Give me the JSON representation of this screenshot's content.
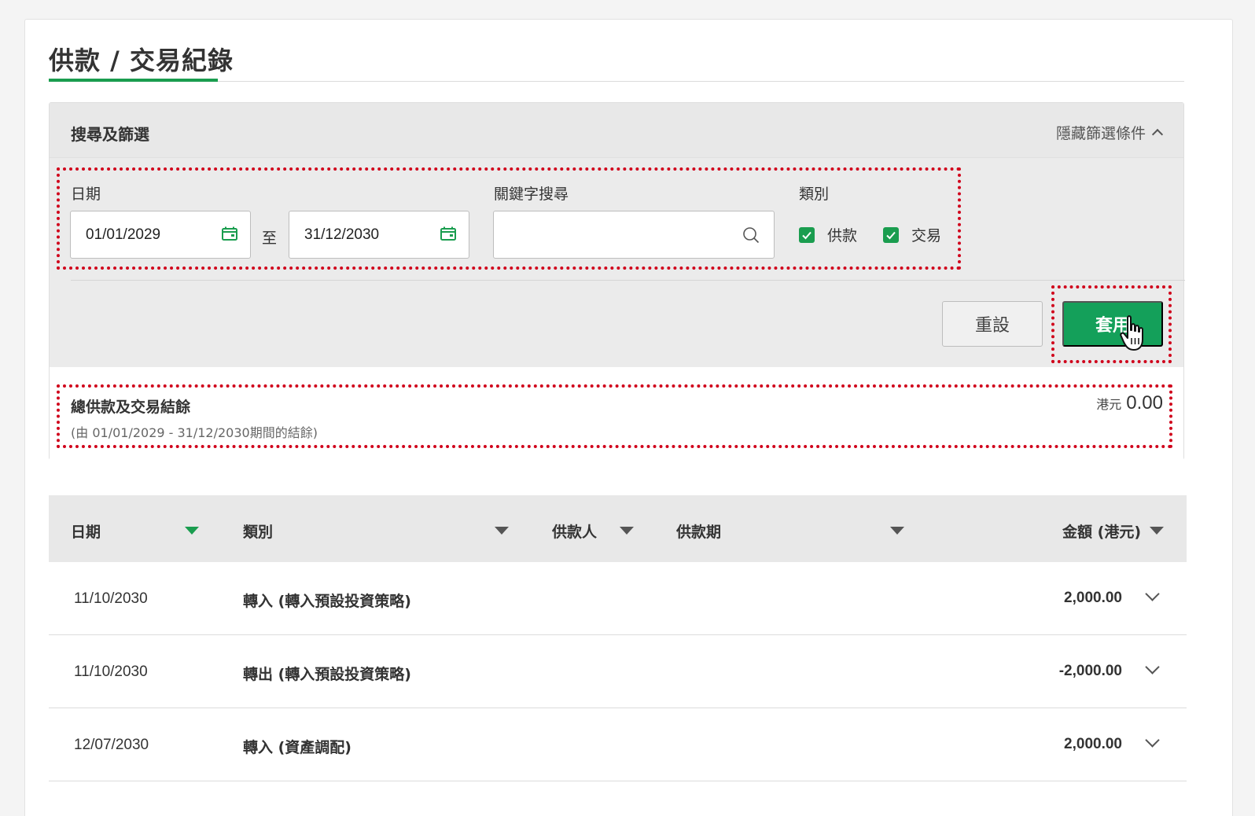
{
  "page": {
    "title": "供款 / 交易紀錄"
  },
  "filter": {
    "title": "搜尋及篩選",
    "toggle_label": "隱藏篩選條件",
    "date_label": "日期",
    "date_from": "01/01/2029",
    "date_separator": "至",
    "date_to": "31/12/2030",
    "keyword_label": "關鍵字搜尋",
    "keyword_value": "",
    "category_label": "類別",
    "categories": [
      {
        "label": "供款",
        "checked": true
      },
      {
        "label": "交易",
        "checked": true
      }
    ],
    "reset_label": "重設",
    "apply_label": "套用"
  },
  "summary": {
    "title": "總供款及交易結餘",
    "range_text": "(由 01/01/2029 - 31/12/2030期間的結餘)",
    "currency": "港元",
    "amount": "0.00"
  },
  "table": {
    "headers": {
      "date": "日期",
      "type": "類別",
      "contributor": "供款人",
      "period": "供款期",
      "amount": "金額 (港元)"
    },
    "rows": [
      {
        "date": "11/10/2030",
        "type": "轉入 (轉入預設投資策略)",
        "amount": "2,000.00"
      },
      {
        "date": "11/10/2030",
        "type": "轉出 (轉入預設投資策略)",
        "amount": "-2,000.00"
      },
      {
        "date": "12/07/2030",
        "type": "轉入 (資產調配)",
        "amount": "2,000.00"
      }
    ]
  },
  "colors": {
    "accent": "#1a9d4f",
    "highlight": "#d0021b"
  }
}
